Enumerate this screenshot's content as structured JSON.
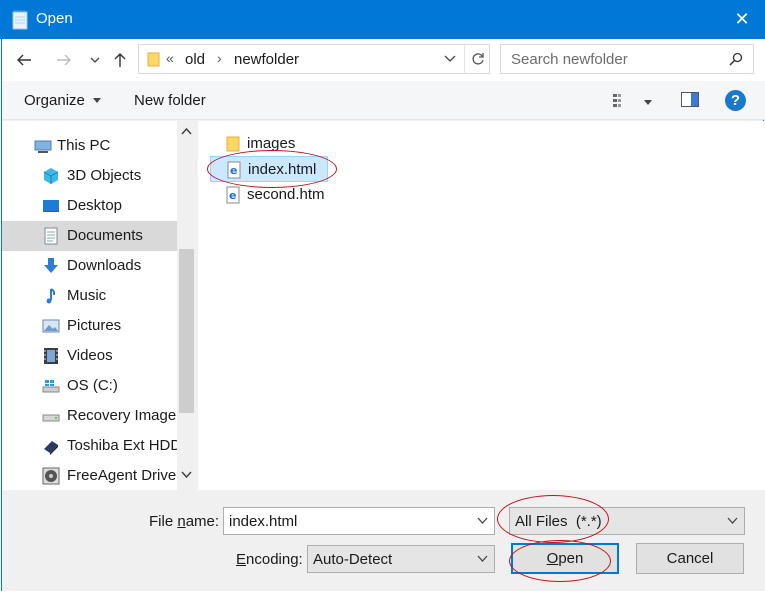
{
  "window": {
    "title": "Open",
    "close_glyph": "✕"
  },
  "nav": {
    "back_icon": "arrow-left",
    "forward_icon": "arrow-right",
    "recent_icon": "chevron-down",
    "up_icon": "arrow-up",
    "breadcrumb_prefix": "«",
    "breadcrumbs": [
      "old",
      "newfolder"
    ],
    "crumb_sep": "›",
    "search_placeholder": "Search newfolder"
  },
  "toolbar": {
    "organize_label": "Organize",
    "new_folder_label": "New folder",
    "help_glyph": "?"
  },
  "tree": {
    "items": [
      {
        "label": "This PC",
        "icon": "this-pc"
      },
      {
        "label": "3D Objects",
        "icon": "3d-objects"
      },
      {
        "label": "Desktop",
        "icon": "desktop"
      },
      {
        "label": "Documents",
        "icon": "documents",
        "selected": true
      },
      {
        "label": "Downloads",
        "icon": "downloads"
      },
      {
        "label": "Music",
        "icon": "music"
      },
      {
        "label": "Pictures",
        "icon": "pictures"
      },
      {
        "label": "Videos",
        "icon": "videos"
      },
      {
        "label": "OS (C:)",
        "icon": "drive-c"
      },
      {
        "label": "Recovery Image",
        "icon": "drive"
      },
      {
        "label": "Toshiba Ext HDD",
        "icon": "external-drive"
      },
      {
        "label": "FreeAgent Drive",
        "icon": "external-drive"
      }
    ]
  },
  "files": {
    "items": [
      {
        "label": "images",
        "icon": "folder"
      },
      {
        "label": "index.html",
        "icon": "edge-html",
        "selected": true
      },
      {
        "label": "second.htm",
        "icon": "edge-html"
      }
    ]
  },
  "footer": {
    "file_name_prefix": "File ",
    "file_name_underlined": "n",
    "file_name_suffix": "ame:",
    "file_name_value": "index.html",
    "file_type_value": "All Files  (*.*)",
    "encoding_underlined": "E",
    "encoding_suffix": "ncoding:",
    "encoding_value": "Auto-Detect",
    "open_underlined": "O",
    "open_suffix": "pen",
    "cancel_label": "Cancel"
  },
  "colors": {
    "titlebar": "#0078d7",
    "selection": "#cce8ff",
    "annotation": "#c0151b"
  }
}
